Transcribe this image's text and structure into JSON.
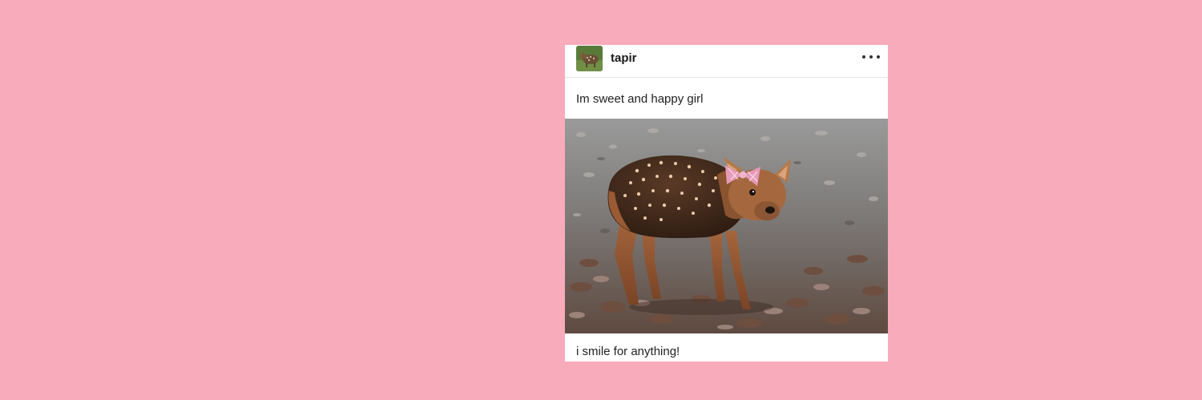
{
  "colors": {
    "background": "#f8abbb",
    "card": "#ffffff",
    "text": "#222222"
  },
  "post": {
    "username": "tapir",
    "avatar_icon": "deer-avatar-icon",
    "more_icon": "more-options-icon",
    "caption_top": "Im sweet and happy girl",
    "caption_bottom": "i smile for anything!",
    "photo_subject": "baby pudu deer with pink bow on wood chips"
  }
}
